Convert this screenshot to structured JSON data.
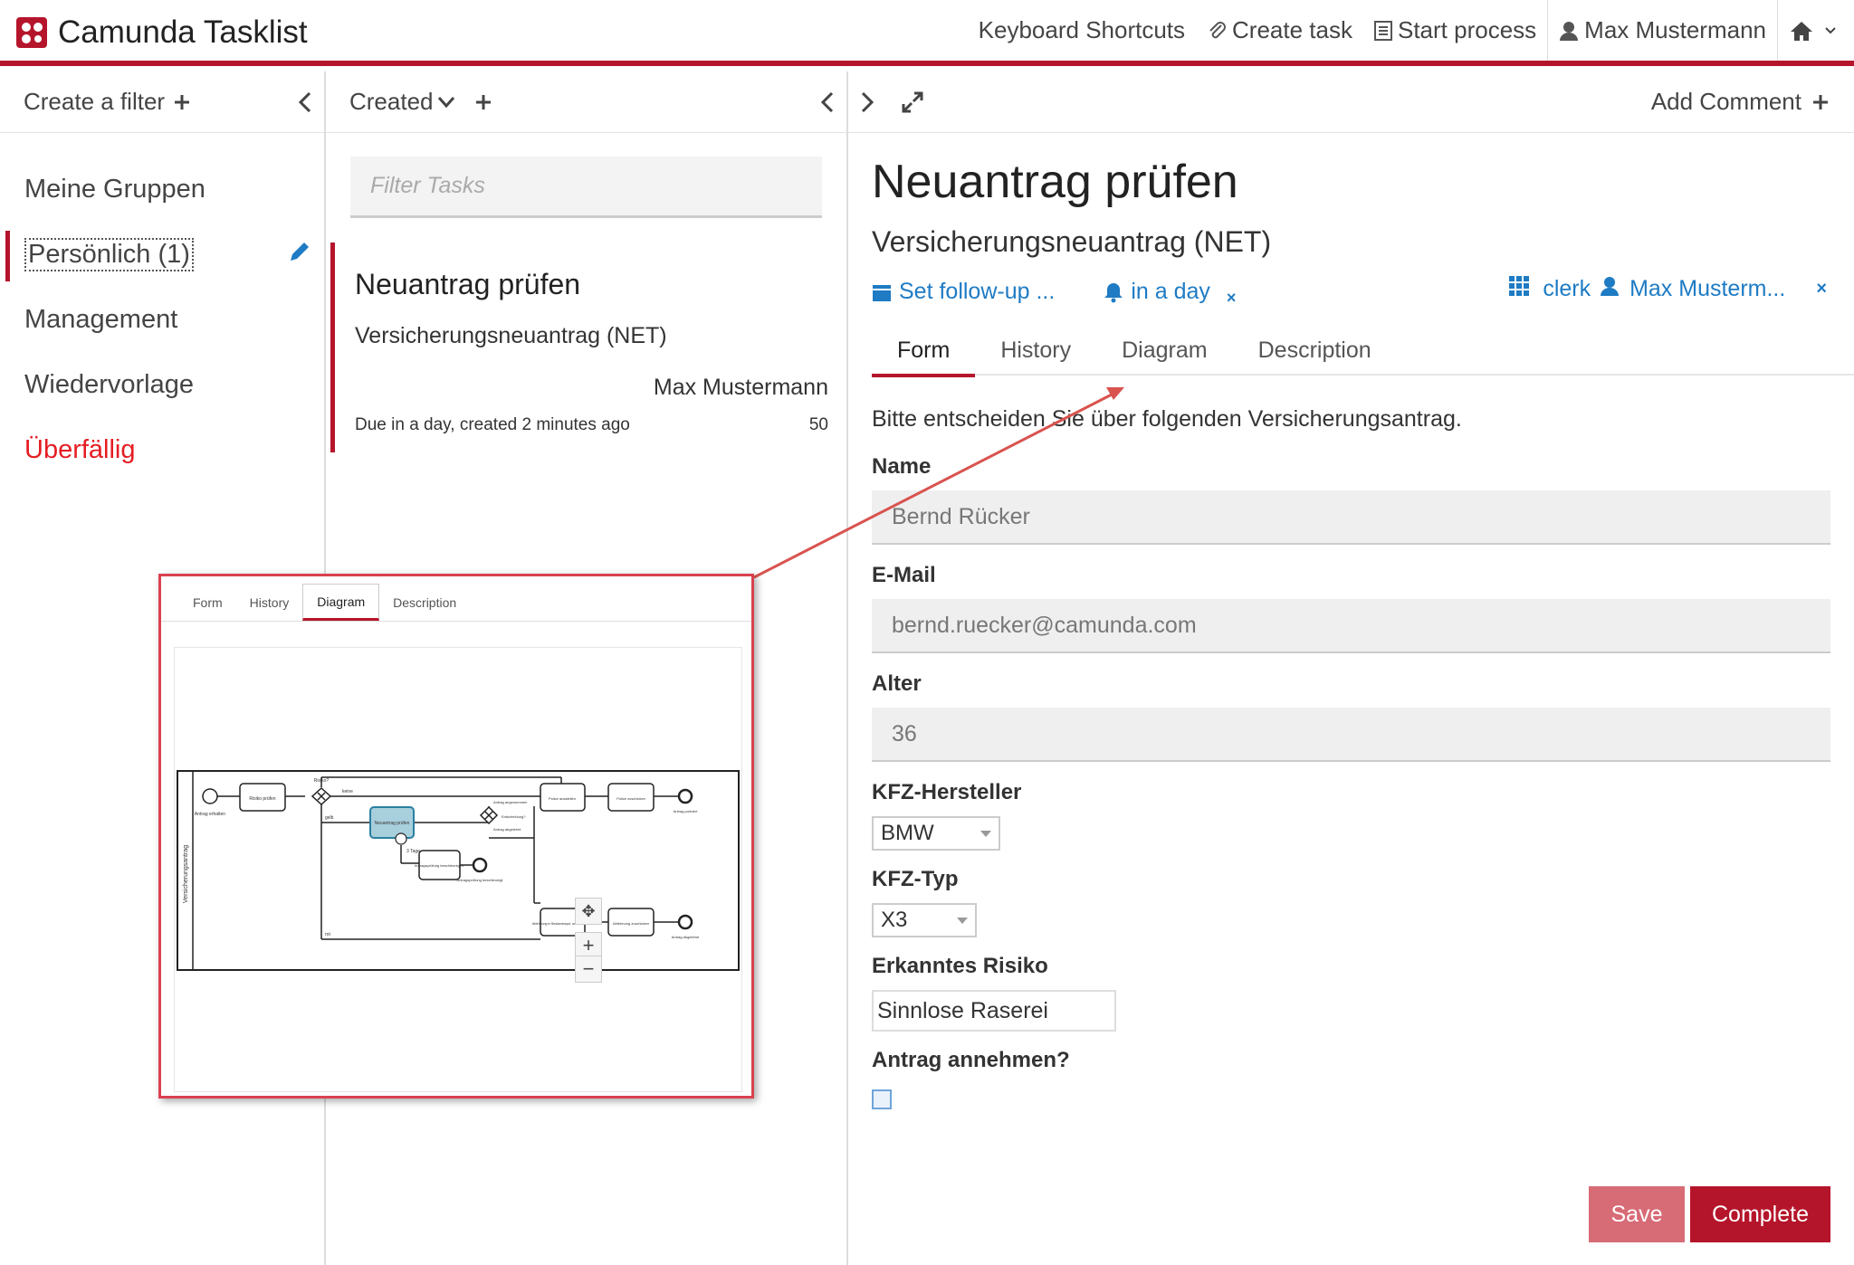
{
  "header": {
    "app_title": "Camunda Tasklist",
    "nav": {
      "shortcuts": "Keyboard Shortcuts",
      "create_task": "Create task",
      "start_process": "Start process",
      "user": "Max Mustermann"
    }
  },
  "filters_panel": {
    "create_filter": "Create a filter",
    "items": [
      {
        "label": "Meine Gruppen"
      },
      {
        "label": "Persönlich (1)"
      },
      {
        "label": "Management"
      },
      {
        "label": "Wiedervorlage"
      },
      {
        "label": "Überfällig"
      }
    ]
  },
  "list_panel": {
    "sort_label": "Created",
    "search_placeholder": "Filter Tasks",
    "task": {
      "title": "Neuantrag prüfen",
      "process": "Versicherungsneuantrag (NET)",
      "assignee": "Max Mustermann",
      "meta": "Due in a day, created 2 minutes ago",
      "priority": "50"
    }
  },
  "detail_panel": {
    "add_comment": "Add Comment",
    "title": "Neuantrag prüfen",
    "process": "Versicherungsneuantrag (NET)",
    "follow_up": "Set follow-up ...",
    "due": "in a day",
    "group": "clerk",
    "assignee": "Max Musterm...",
    "tabs": [
      "Form",
      "History",
      "Diagram",
      "Description"
    ],
    "form": {
      "intro": "Bitte entscheiden Sie über folgenden Versicherungsantrag.",
      "name_label": "Name",
      "name_value": "Bernd Rücker",
      "email_label": "E-Mail",
      "email_value": "bernd.ruecker@camunda.com",
      "age_label": "Alter",
      "age_value": "36",
      "maker_label": "KFZ-Hersteller",
      "maker_value": "BMW",
      "type_label": "KFZ-Typ",
      "type_value": "X3",
      "risk_label": "Erkanntes Risiko",
      "risk_value": "Sinnlose Raserei",
      "accept_label": "Antrag annehmen?",
      "accept_checked": false
    },
    "save_label": "Save",
    "complete_label": "Complete"
  },
  "diagram_overlay": {
    "tabs": [
      "Form",
      "History",
      "Diagram",
      "Description"
    ],
    "pool_label": "Versicherungsantrag",
    "labels": {
      "start": "Antrag erhalten",
      "risk_task": "Risiko prüfen",
      "gateway_q": "Risiko?",
      "no": "keine",
      "yes": "gelb",
      "red": "rot",
      "review_task": "Neuantrag prüfen",
      "timer": "3 Tage",
      "escalate_task": "Antragsprüfung beschleunigen",
      "escalated_end": "Antragsprüfung beschleunigt",
      "decision": "Entscheidung?",
      "accepted": "Antrag angenommen",
      "rejected": "Antrag abgelehnt",
      "policy_task": "Police ausstellen",
      "send_policy": "Police zuschicken",
      "issued_end": "Antrag policiert",
      "reject_task": "Ablehnung in Bestandssyst. am vermerken",
      "send_reject": "Ablehnung zuschicken",
      "rejected_end": "Antrag abgelehnt"
    }
  },
  "colors": {
    "brand": "#b5152b",
    "link": "#1e7bc4",
    "overdue": "#e51c23"
  }
}
